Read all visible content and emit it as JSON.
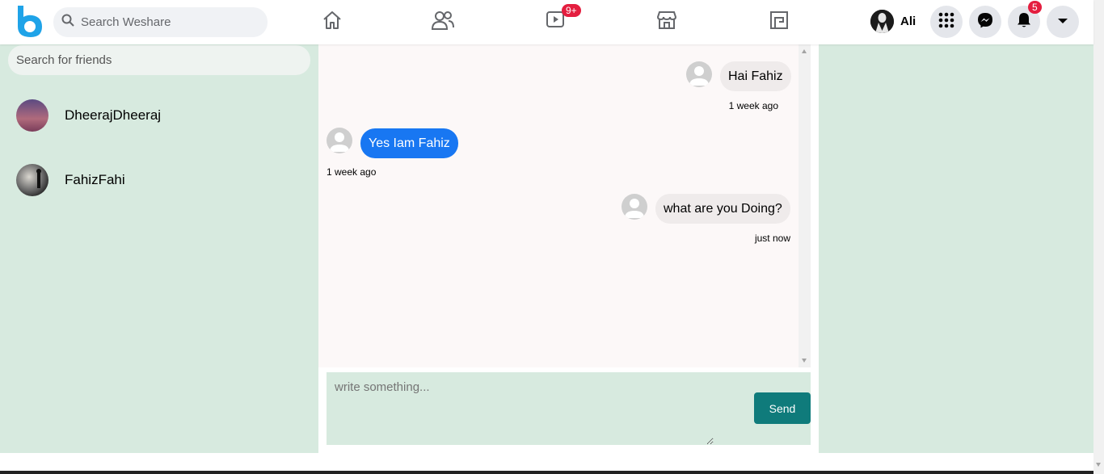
{
  "app": {
    "name": "Weshare"
  },
  "header": {
    "search_placeholder": "Search Weshare",
    "nav": [
      {
        "icon": "home-icon"
      },
      {
        "icon": "friends-icon"
      },
      {
        "icon": "watch-icon",
        "badge": "9+"
      },
      {
        "icon": "marketplace-icon"
      },
      {
        "icon": "groups-icon"
      }
    ],
    "user_name": "Ali",
    "notifications_badge": "5"
  },
  "sidebar": {
    "search_placeholder": "Search for friends",
    "friends": [
      {
        "name": "DheerajDheeraj"
      },
      {
        "name": "FahizFahi"
      }
    ]
  },
  "chat": {
    "messages": [
      {
        "text": "Hai Fahiz",
        "time": "1 week ago",
        "own": false
      },
      {
        "text": "Yes Iam Fahiz",
        "time": "1 week ago",
        "own": true
      },
      {
        "text": "what are you Doing?",
        "time": "just now",
        "own": false
      }
    ],
    "composer_placeholder": "write something...",
    "send_label": "Send"
  },
  "colors": {
    "accent": "#1877f2",
    "sidebar_bg": "#d7eadf",
    "send_button": "#0f7b7b",
    "badge": "#e41e3f"
  }
}
